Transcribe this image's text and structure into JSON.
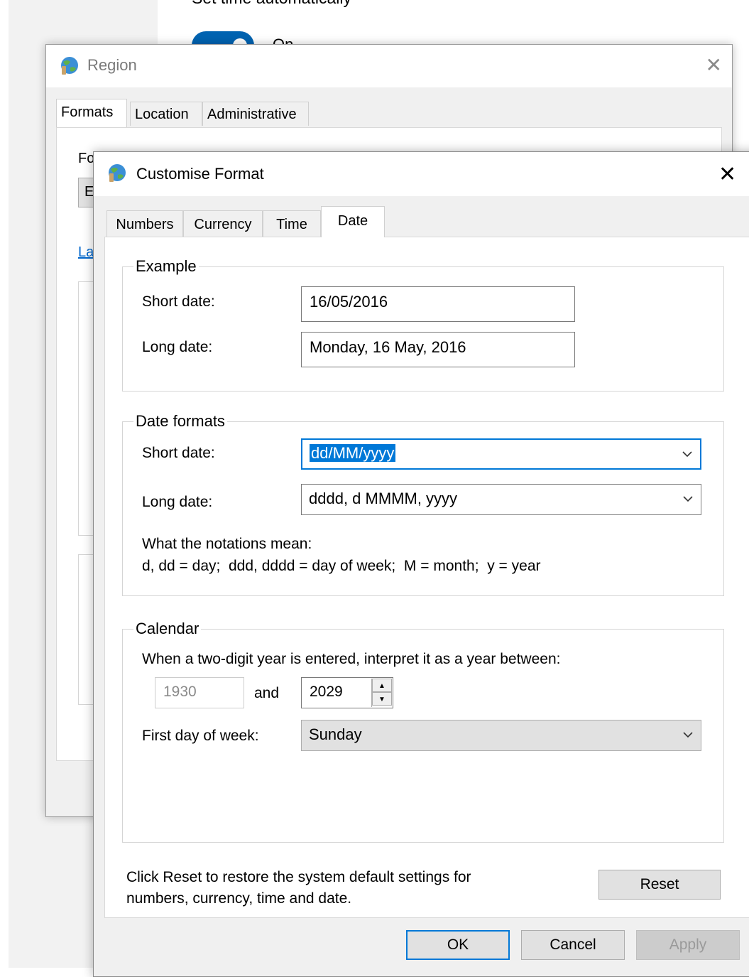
{
  "settings": {
    "heading": "Set time automatically",
    "toggle_label": "On"
  },
  "region": {
    "title": "Region",
    "tabs": [
      "Formats",
      "Location",
      "Administrative"
    ],
    "partial_label_fo": "Fo",
    "partial_field_e": "E",
    "partial_link_la": "La"
  },
  "dialog": {
    "title": "Customise Format",
    "tabs": [
      "Numbers",
      "Currency",
      "Time",
      "Date"
    ],
    "active_tab": "Date",
    "example": {
      "legend": "Example",
      "short_label": "Short date:",
      "short_value": "16/05/2016",
      "long_label": "Long date:",
      "long_value": "Monday, 16 May, 2016"
    },
    "date_formats": {
      "legend": "Date formats",
      "short_label": "Short date:",
      "short_value": "dd/MM/yyyy",
      "long_label": "Long date:",
      "long_value": "dddd, d MMMM, yyyy",
      "notation_title": "What the notations mean:",
      "notation_text": "d, dd = day;  ddd, dddd = day of week;  M = month;  y = year"
    },
    "calendar": {
      "legend": "Calendar",
      "instruction": "When a two-digit year is entered, interpret it as a year between:",
      "year_from": "1930",
      "and_label": "and",
      "year_to": "2029",
      "first_day_label": "First day of week:",
      "first_day_value": "Sunday"
    },
    "reset_text_line1": "Click Reset to restore the system default settings for",
    "reset_text_line2": "numbers, currency, time and date.",
    "buttons": {
      "reset": "Reset",
      "ok": "OK",
      "cancel": "Cancel",
      "apply": "Apply"
    }
  }
}
